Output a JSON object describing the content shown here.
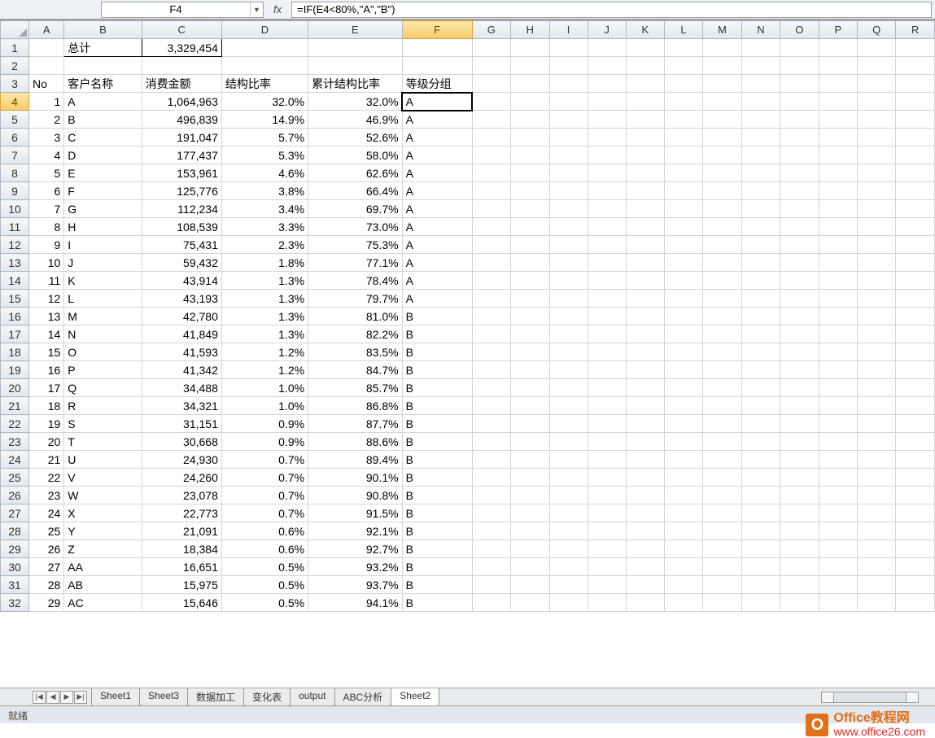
{
  "formula_bar": {
    "cell_ref": "F4",
    "fx_label": "fx",
    "formula": "=IF(E4<80%,\"A\",\"B\")"
  },
  "col_headers": [
    "A",
    "B",
    "C",
    "D",
    "E",
    "F",
    "G",
    "H",
    "I",
    "J",
    "K",
    "L",
    "M",
    "N",
    "O",
    "P",
    "Q",
    "R"
  ],
  "active_col": "F",
  "active_row": 4,
  "total_label": "总计",
  "total_value": "3,329,454",
  "headers": {
    "A": "No",
    "B": "客户名称",
    "C": "消费金额",
    "D": "结构比率",
    "E": "累计结构比率",
    "F": "等级分组"
  },
  "rows": [
    {
      "r": 4,
      "no": "1",
      "name": "A",
      "amt": "1,064,963",
      "pct": "32.0%",
      "cum": "32.0%",
      "grade": "A"
    },
    {
      "r": 5,
      "no": "2",
      "name": "B",
      "amt": "496,839",
      "pct": "14.9%",
      "cum": "46.9%",
      "grade": "A"
    },
    {
      "r": 6,
      "no": "3",
      "name": "C",
      "amt": "191,047",
      "pct": "5.7%",
      "cum": "52.6%",
      "grade": "A"
    },
    {
      "r": 7,
      "no": "4",
      "name": "D",
      "amt": "177,437",
      "pct": "5.3%",
      "cum": "58.0%",
      "grade": "A"
    },
    {
      "r": 8,
      "no": "5",
      "name": "E",
      "amt": "153,961",
      "pct": "4.6%",
      "cum": "62.6%",
      "grade": "A"
    },
    {
      "r": 9,
      "no": "6",
      "name": "F",
      "amt": "125,776",
      "pct": "3.8%",
      "cum": "66.4%",
      "grade": "A"
    },
    {
      "r": 10,
      "no": "7",
      "name": "G",
      "amt": "112,234",
      "pct": "3.4%",
      "cum": "69.7%",
      "grade": "A"
    },
    {
      "r": 11,
      "no": "8",
      "name": "H",
      "amt": "108,539",
      "pct": "3.3%",
      "cum": "73.0%",
      "grade": "A"
    },
    {
      "r": 12,
      "no": "9",
      "name": "I",
      "amt": "75,431",
      "pct": "2.3%",
      "cum": "75.3%",
      "grade": "A"
    },
    {
      "r": 13,
      "no": "10",
      "name": "J",
      "amt": "59,432",
      "pct": "1.8%",
      "cum": "77.1%",
      "grade": "A"
    },
    {
      "r": 14,
      "no": "11",
      "name": "K",
      "amt": "43,914",
      "pct": "1.3%",
      "cum": "78.4%",
      "grade": "A"
    },
    {
      "r": 15,
      "no": "12",
      "name": "L",
      "amt": "43,193",
      "pct": "1.3%",
      "cum": "79.7%",
      "grade": "A"
    },
    {
      "r": 16,
      "no": "13",
      "name": "M",
      "amt": "42,780",
      "pct": "1.3%",
      "cum": "81.0%",
      "grade": "B"
    },
    {
      "r": 17,
      "no": "14",
      "name": "N",
      "amt": "41,849",
      "pct": "1.3%",
      "cum": "82.2%",
      "grade": "B"
    },
    {
      "r": 18,
      "no": "15",
      "name": "O",
      "amt": "41,593",
      "pct": "1.2%",
      "cum": "83.5%",
      "grade": "B"
    },
    {
      "r": 19,
      "no": "16",
      "name": "P",
      "amt": "41,342",
      "pct": "1.2%",
      "cum": "84.7%",
      "grade": "B"
    },
    {
      "r": 20,
      "no": "17",
      "name": "Q",
      "amt": "34,488",
      "pct": "1.0%",
      "cum": "85.7%",
      "grade": "B"
    },
    {
      "r": 21,
      "no": "18",
      "name": "R",
      "amt": "34,321",
      "pct": "1.0%",
      "cum": "86.8%",
      "grade": "B"
    },
    {
      "r": 22,
      "no": "19",
      "name": "S",
      "amt": "31,151",
      "pct": "0.9%",
      "cum": "87.7%",
      "grade": "B"
    },
    {
      "r": 23,
      "no": "20",
      "name": "T",
      "amt": "30,668",
      "pct": "0.9%",
      "cum": "88.6%",
      "grade": "B"
    },
    {
      "r": 24,
      "no": "21",
      "name": "U",
      "amt": "24,930",
      "pct": "0.7%",
      "cum": "89.4%",
      "grade": "B"
    },
    {
      "r": 25,
      "no": "22",
      "name": "V",
      "amt": "24,260",
      "pct": "0.7%",
      "cum": "90.1%",
      "grade": "B"
    },
    {
      "r": 26,
      "no": "23",
      "name": "W",
      "amt": "23,078",
      "pct": "0.7%",
      "cum": "90.8%",
      "grade": "B"
    },
    {
      "r": 27,
      "no": "24",
      "name": "X",
      "amt": "22,773",
      "pct": "0.7%",
      "cum": "91.5%",
      "grade": "B"
    },
    {
      "r": 28,
      "no": "25",
      "name": "Y",
      "amt": "21,091",
      "pct": "0.6%",
      "cum": "92.1%",
      "grade": "B"
    },
    {
      "r": 29,
      "no": "26",
      "name": "Z",
      "amt": "18,384",
      "pct": "0.6%",
      "cum": "92.7%",
      "grade": "B"
    },
    {
      "r": 30,
      "no": "27",
      "name": "AA",
      "amt": "16,651",
      "pct": "0.5%",
      "cum": "93.2%",
      "grade": "B"
    },
    {
      "r": 31,
      "no": "28",
      "name": "AB",
      "amt": "15,975",
      "pct": "0.5%",
      "cum": "93.7%",
      "grade": "B"
    },
    {
      "r": 32,
      "no": "29",
      "name": "AC",
      "amt": "15,646",
      "pct": "0.5%",
      "cum": "94.1%",
      "grade": "B"
    }
  ],
  "sheet_tabs": [
    "Sheet1",
    "Sheet3",
    "数据加工",
    "变化表",
    "output",
    "ABC分析",
    "Sheet2"
  ],
  "active_tab": "Sheet2",
  "status_text": "就绪",
  "watermark": {
    "logo": "O",
    "line1": "Office教程网",
    "line2": "www.office26.com"
  }
}
